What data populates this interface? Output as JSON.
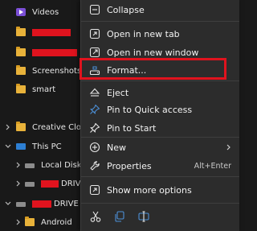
{
  "explorer": {
    "items": [
      {
        "label": "Videos"
      },
      {
        "label": ""
      },
      {
        "label": ""
      },
      {
        "label": "Screenshots"
      },
      {
        "label": "smart"
      },
      {
        "label": "Creative Cloud F"
      },
      {
        "label": "This PC"
      },
      {
        "label": "Local Disk (C:)"
      },
      {
        "label": "DRIVE ("
      },
      {
        "label": "DRIVE (D"
      },
      {
        "label": "Android"
      }
    ]
  },
  "context_menu": {
    "items": [
      {
        "label": "Collapse",
        "icon": "collapse-icon"
      },
      {
        "label": "Open in new tab",
        "icon": "open-new-tab-icon"
      },
      {
        "label": "Open in new window",
        "icon": "open-new-window-icon"
      },
      {
        "label": "Format...",
        "icon": "format-drive-icon"
      },
      {
        "label": "Eject",
        "icon": "eject-icon"
      },
      {
        "label": "Pin to Quick access",
        "icon": "pin-icon"
      },
      {
        "label": "Pin to Start",
        "icon": "pin-icon"
      },
      {
        "label": "New",
        "icon": "plus-circle-icon"
      },
      {
        "label": "Properties",
        "icon": "wrench-icon",
        "shortcut": "Alt+Enter"
      },
      {
        "label": "Show more options",
        "icon": "show-more-options-icon"
      }
    ],
    "bottom_actions": [
      {
        "icon": "cut-icon"
      },
      {
        "icon": "copy-icon"
      },
      {
        "icon": "rename-icon"
      }
    ]
  },
  "colors": {
    "menu_bg": "#2c2c2c",
    "explorer_bg": "#191919",
    "highlight": "#e0131e",
    "accent": "#4c8fd6",
    "folder": "#e8b23a"
  }
}
